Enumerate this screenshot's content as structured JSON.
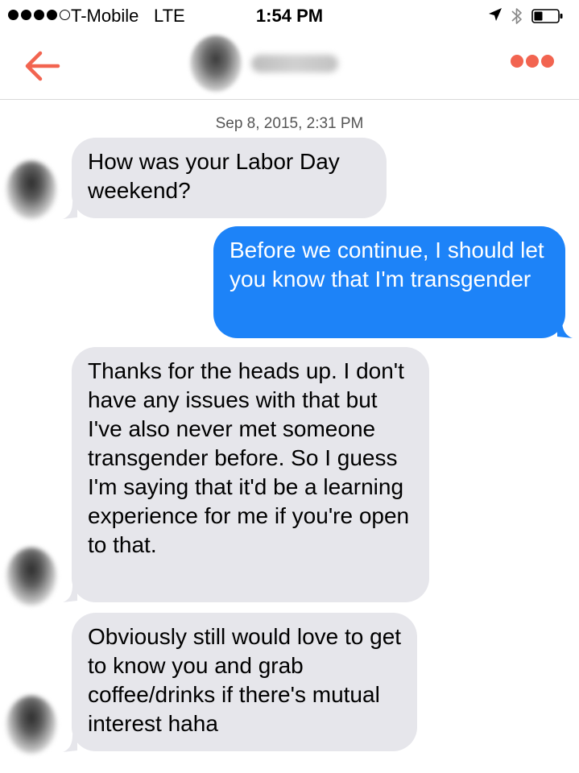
{
  "status_bar": {
    "carrier": "T-Mobile",
    "network": "LTE",
    "time": "1:54 PM",
    "signal_bars_filled": 4,
    "signal_bars_total": 5
  },
  "header": {
    "back_icon": "arrow-left-icon",
    "more_icon": "ellipsis-icon",
    "accent_color": "#f26450"
  },
  "conversation": {
    "timestamp": "Sep 8, 2015, 2:31 PM",
    "messages": [
      {
        "sender": "them",
        "text": "How was your Labor Day weekend?"
      },
      {
        "sender": "me",
        "text": "Before we continue, I should let you know that I'm transgender"
      },
      {
        "sender": "them",
        "text": "Thanks for the heads up. I don't have any issues with that but I've also never met someone transgender before. So I guess I'm saying that it'd be a learning experience for me if you're open to that."
      },
      {
        "sender": "them",
        "text": "Obviously still would love to get to know you and grab coffee/drinks if there's mutual interest haha"
      }
    ]
  },
  "colors": {
    "incoming_bubble": "#e6e6eb",
    "outgoing_bubble": "#1d83f8"
  }
}
